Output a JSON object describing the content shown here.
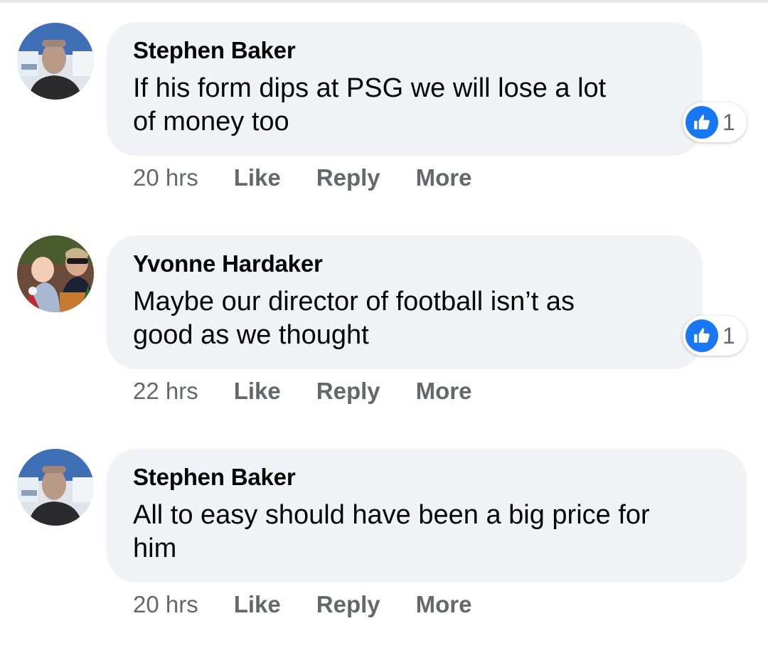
{
  "comments": [
    {
      "author": "Stephen Baker",
      "text_lines": [
        "If his form dips at PSG we will lose a lot",
        "of money too"
      ],
      "time": "20 hrs",
      "actions": [
        "Like",
        "Reply",
        "More"
      ],
      "reaction_count": "1"
    },
    {
      "author": "Yvonne Hardaker",
      "text_lines": [
        "Maybe our director of football isn’t as",
        "good as we thought"
      ],
      "time": "22 hrs",
      "actions": [
        "Like",
        "Reply",
        "More"
      ],
      "reaction_count": "1"
    },
    {
      "author": "Stephen Baker",
      "text_lines": [
        "All to easy should have been a big price for",
        "him"
      ],
      "time": "20 hrs",
      "actions": [
        "Like",
        "Reply",
        "More"
      ]
    }
  ],
  "icons": {
    "reaction": "thumbs-up-icon"
  },
  "colors": {
    "bubble": "#f0f2f5",
    "like_blue": "#1877f2",
    "meta_gray": "#65676b",
    "text": "#050505"
  }
}
